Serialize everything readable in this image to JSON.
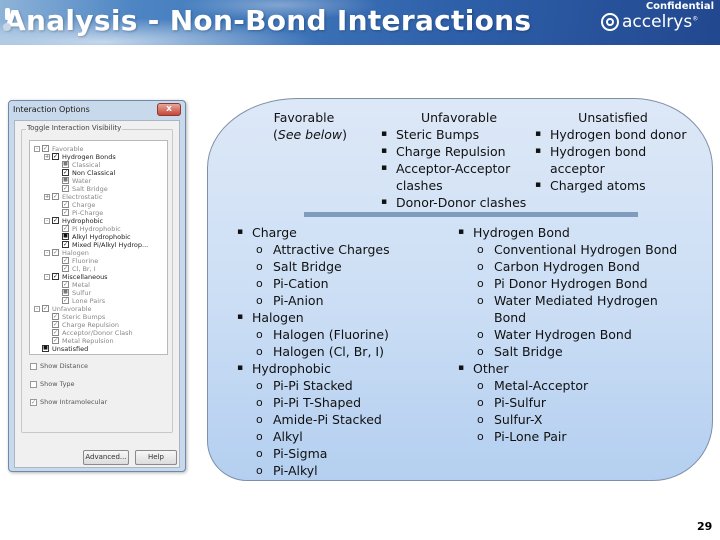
{
  "header": {
    "title": "Analysis - Non-Bond Interactions",
    "confidential": "Confidential",
    "logo_text": "accelrys",
    "logo_sup": "®"
  },
  "dialog": {
    "title": "Interaction Options",
    "close_label": "x",
    "group_legend": "Toggle Interaction Visibility",
    "tree": [
      {
        "label": "Favorable",
        "level": 0,
        "expander": "-",
        "checked": true,
        "style": "dim"
      },
      {
        "label": "Hydrogen Bonds",
        "level": 1,
        "expander": "+",
        "checked": true,
        "style": "dark"
      },
      {
        "label": "Classical",
        "level": 2,
        "checked": "partial",
        "style": "dim"
      },
      {
        "label": "Non Classical",
        "level": 2,
        "checked": true,
        "style": "dark"
      },
      {
        "label": "Water",
        "level": 2,
        "checked": "partial",
        "style": "dim"
      },
      {
        "label": "Salt Bridge",
        "level": 2,
        "checked": true,
        "style": "dim"
      },
      {
        "label": "Electrostatic",
        "level": 1,
        "expander": "+",
        "checked": true,
        "style": "dim"
      },
      {
        "label": "Charge",
        "level": 2,
        "checked": true,
        "style": "dim"
      },
      {
        "label": "Pi-Charge",
        "level": 2,
        "checked": true,
        "style": "dim"
      },
      {
        "label": "Hydrophobic",
        "level": 1,
        "expander": "-",
        "checked": true,
        "style": "dark"
      },
      {
        "label": "Pi Hydrophobic",
        "level": 2,
        "checked": true,
        "style": "dim"
      },
      {
        "label": "Alkyl Hydrophobic",
        "level": 2,
        "checked": "partial",
        "style": "dark"
      },
      {
        "label": "Mixed Pi/Alkyl Hydrop...",
        "level": 2,
        "checked": true,
        "style": "dark"
      },
      {
        "label": "Halogen",
        "level": 1,
        "expander": "-",
        "checked": true,
        "style": "dim"
      },
      {
        "label": "Fluorine",
        "level": 2,
        "checked": true,
        "style": "dim"
      },
      {
        "label": "Cl, Br, I",
        "level": 2,
        "checked": true,
        "style": "dim"
      },
      {
        "label": "Miscellaneous",
        "level": 1,
        "expander": "-",
        "checked": true,
        "style": "dark"
      },
      {
        "label": "Metal",
        "level": 2,
        "checked": true,
        "style": "dim"
      },
      {
        "label": "Sulfur",
        "level": 2,
        "checked": "partial",
        "style": "dim"
      },
      {
        "label": "Lone Pairs",
        "level": 2,
        "checked": true,
        "style": "dim"
      },
      {
        "label": "Unfavorable",
        "level": 0,
        "expander": "-",
        "checked": true,
        "style": "dim"
      },
      {
        "label": "Steric Bumps",
        "level": 1,
        "checked": true,
        "style": "dim"
      },
      {
        "label": "Charge Repulsion",
        "level": 1,
        "checked": true,
        "style": "dim"
      },
      {
        "label": "Acceptor/Donor Clash",
        "level": 1,
        "checked": true,
        "style": "dim"
      },
      {
        "label": "Metal Repulsion",
        "level": 1,
        "checked": true,
        "style": "dim"
      },
      {
        "label": "Unsatisfied",
        "level": 0,
        "checked": "partial",
        "style": "dark"
      }
    ],
    "options": [
      {
        "label": "Show Distance",
        "checked": false
      },
      {
        "label": "Show Type",
        "checked": false
      },
      {
        "label": "Show Intramolecular",
        "checked": true
      }
    ],
    "buttons": {
      "advanced": "Advanced...",
      "help": "Help"
    }
  },
  "panel": {
    "favorable": {
      "heading": "Favorable",
      "note_open": "(",
      "note_italic": "See below",
      "note_close": ")"
    },
    "unfavorable": {
      "heading": "Unfavorable",
      "items": [
        "Steric Bumps",
        "Charge Repulsion",
        "Acceptor-Acceptor",
        "Donor-Donor clashes"
      ],
      "item3_cont": "clashes"
    },
    "unsatisfied": {
      "heading": "Unsatisfied",
      "items": [
        "Hydrogen bond donor",
        "Hydrogen bond",
        "Charged atoms"
      ],
      "item2_cont": "acceptor"
    },
    "left_list": [
      {
        "label": "Charge",
        "children": [
          "Attractive Charges",
          "Salt Bridge",
          "Pi-Cation",
          "Pi-Anion"
        ]
      },
      {
        "label": "Halogen",
        "children": [
          "Halogen (Fluorine)",
          "Halogen (Cl, Br, I)"
        ]
      },
      {
        "label": "Hydrophobic",
        "children": [
          "Pi-Pi Stacked",
          "Pi-Pi T-Shaped",
          "Amide-Pi Stacked",
          "Alkyl",
          "Pi-Sigma",
          "Pi-Alkyl"
        ]
      }
    ],
    "right_list": [
      {
        "label": "Hydrogen Bond",
        "children": [
          "Conventional Hydrogen Bond",
          "Carbon Hydrogen Bond",
          "Pi Donor Hydrogen Bond",
          "Water Mediated Hydrogen",
          "Bond",
          "Water Hydrogen Bond",
          "Salt Bridge"
        ]
      },
      {
        "label": "Other",
        "children": [
          "Metal-Acceptor",
          "Pi-Sulfur",
          "Sulfur-X",
          "Pi-Lone Pair"
        ]
      }
    ],
    "bullet_glyph": "▪",
    "sub_glyph": "o"
  },
  "footer": {
    "page_number": "29"
  }
}
